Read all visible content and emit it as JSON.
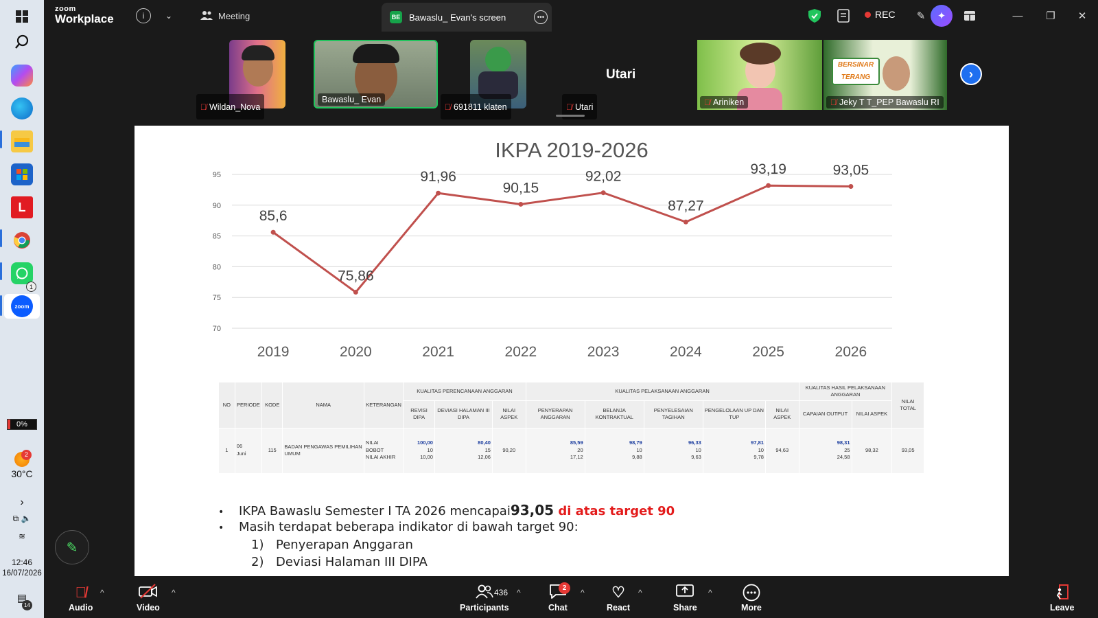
{
  "taskbar": {
    "battery": "0%",
    "weather_temp": "30°C",
    "weather_badge": "2",
    "whatsapp_badge": "1",
    "time": "12:46",
    "date": "16/07/2026",
    "notification_count": "14",
    "icons": [
      "windows-start-icon",
      "search-icon",
      "copilot-icon",
      "edge-icon",
      "file-explorer-icon",
      "microsoft-store-icon",
      "l-app-icon",
      "chrome-icon",
      "whatsapp-icon",
      "zoom-taskbar-icon"
    ]
  },
  "topbar": {
    "logo_line1": "zoom",
    "logo_line2": "Workplace",
    "meeting_label": "Meeting",
    "screen_badge": "BE",
    "screen_tab_label": "Bawaslu_ Evan's screen",
    "rec_label": "REC"
  },
  "participants": [
    {
      "name": "Wildan_Nova",
      "muted": true
    },
    {
      "name": "Bawaslu_ Evan",
      "muted": false,
      "active": true
    },
    {
      "name": "691811 klaten",
      "muted": true
    },
    {
      "name": "Utari",
      "muted": true,
      "video": false
    },
    {
      "name": "Ariniken",
      "muted": true
    },
    {
      "name": "Jeky T T_PEP Bawaslu RI",
      "muted": true
    }
  ],
  "banner_text": "BERSINAR TERANG",
  "slide": {
    "chart_data": {
      "type": "line",
      "title": "IKPA 2019-2026",
      "categories": [
        "2019",
        "2020",
        "2021",
        "2022",
        "2023",
        "2024",
        "2025",
        "2026"
      ],
      "values": [
        85.6,
        75.86,
        91.96,
        90.15,
        92.02,
        87.27,
        93.19,
        93.05
      ],
      "data_labels": [
        "85,6",
        "75,86",
        "91,96",
        "90,15",
        "92,02",
        "87,27",
        "93,19",
        "93,05"
      ],
      "ylim": [
        70,
        95
      ],
      "yticks": [
        "95",
        "90",
        "85",
        "80",
        "75",
        "70"
      ],
      "grid": true,
      "line_color": "#c0504d"
    },
    "table": {
      "headers": {
        "no": "NO",
        "periode": "PERIODE",
        "kode": "KODE",
        "nama": "NAMA",
        "keterangan": "KETERANGAN",
        "group_perencanaan": "KUALITAS PERENCANAAN ANGGARAN",
        "group_pelaksanaan": "KUALITAS PELAKSANAAN ANGGARAN",
        "group_hasil": "KUALITAS HASIL PELAKSANAAN ANGGARAN",
        "nilai_total": "NILAI TOTAL",
        "revisi_dipa": "REVISI DIPA",
        "deviasi": "DEVIASI HALAMAN III DIPA",
        "nilai_aspek_1": "NILAI ASPEK",
        "penyerapan": "PENYERAPAN ANGGARAN",
        "belanja": "BELANJA KONTRAKTUAL",
        "penyelesaian": "PENYELESAIAN TAGIHAN",
        "pengelolaan": "PENGELOLAAN UP DAN TUP",
        "nilai_aspek_2": "NILAI ASPEK",
        "capaian": "CAPAIAN OUTPUT",
        "nilai_aspek_3": "NILAI ASPEK"
      },
      "row": {
        "no": "1",
        "periode_1": "06",
        "periode_2": "Juni",
        "kode": "115",
        "nama": "BADAN PENGAWAS PEMILIHAN UMUM",
        "ket_1": "NILAI",
        "ket_2": "BOBOT",
        "ket_3": "NILAI AKHIR",
        "revisi": [
          "100,00",
          "10",
          "10,00"
        ],
        "deviasi": [
          "80,40",
          "15",
          "12,06"
        ],
        "aspek_1": "90,20",
        "penyerapan": [
          "85,59",
          "20",
          "17,12"
        ],
        "belanja": [
          "98,79",
          "10",
          "9,88"
        ],
        "penyelesaian": [
          "96,33",
          "10",
          "9,63"
        ],
        "pengelolaan": [
          "97,81",
          "10",
          "9,78"
        ],
        "aspek_2": "94,63",
        "capaian": [
          "98,31",
          "25",
          "24,58"
        ],
        "aspek_3": "98,32",
        "total": "93,05"
      }
    },
    "bullets": {
      "b1_prefix": "IKPA Bawaslu Semester I TA 2026 mencapai ",
      "b1_value": "93,05",
      "b1_suffix": " di atas target 90",
      "b2": "Masih terdapat beberapa indikator di bawah target 90:",
      "sub": [
        {
          "num": "1)",
          "text": "Penyerapan Anggaran"
        },
        {
          "num": "2)",
          "text": "Deviasi Halaman III DIPA"
        }
      ]
    }
  },
  "toolbar": {
    "audio": "Audio",
    "video": "Video",
    "participants": "Participants",
    "participant_count": "436",
    "chat": "Chat",
    "chat_badge": "2",
    "react": "React",
    "share": "Share",
    "more": "More",
    "leave": "Leave"
  }
}
